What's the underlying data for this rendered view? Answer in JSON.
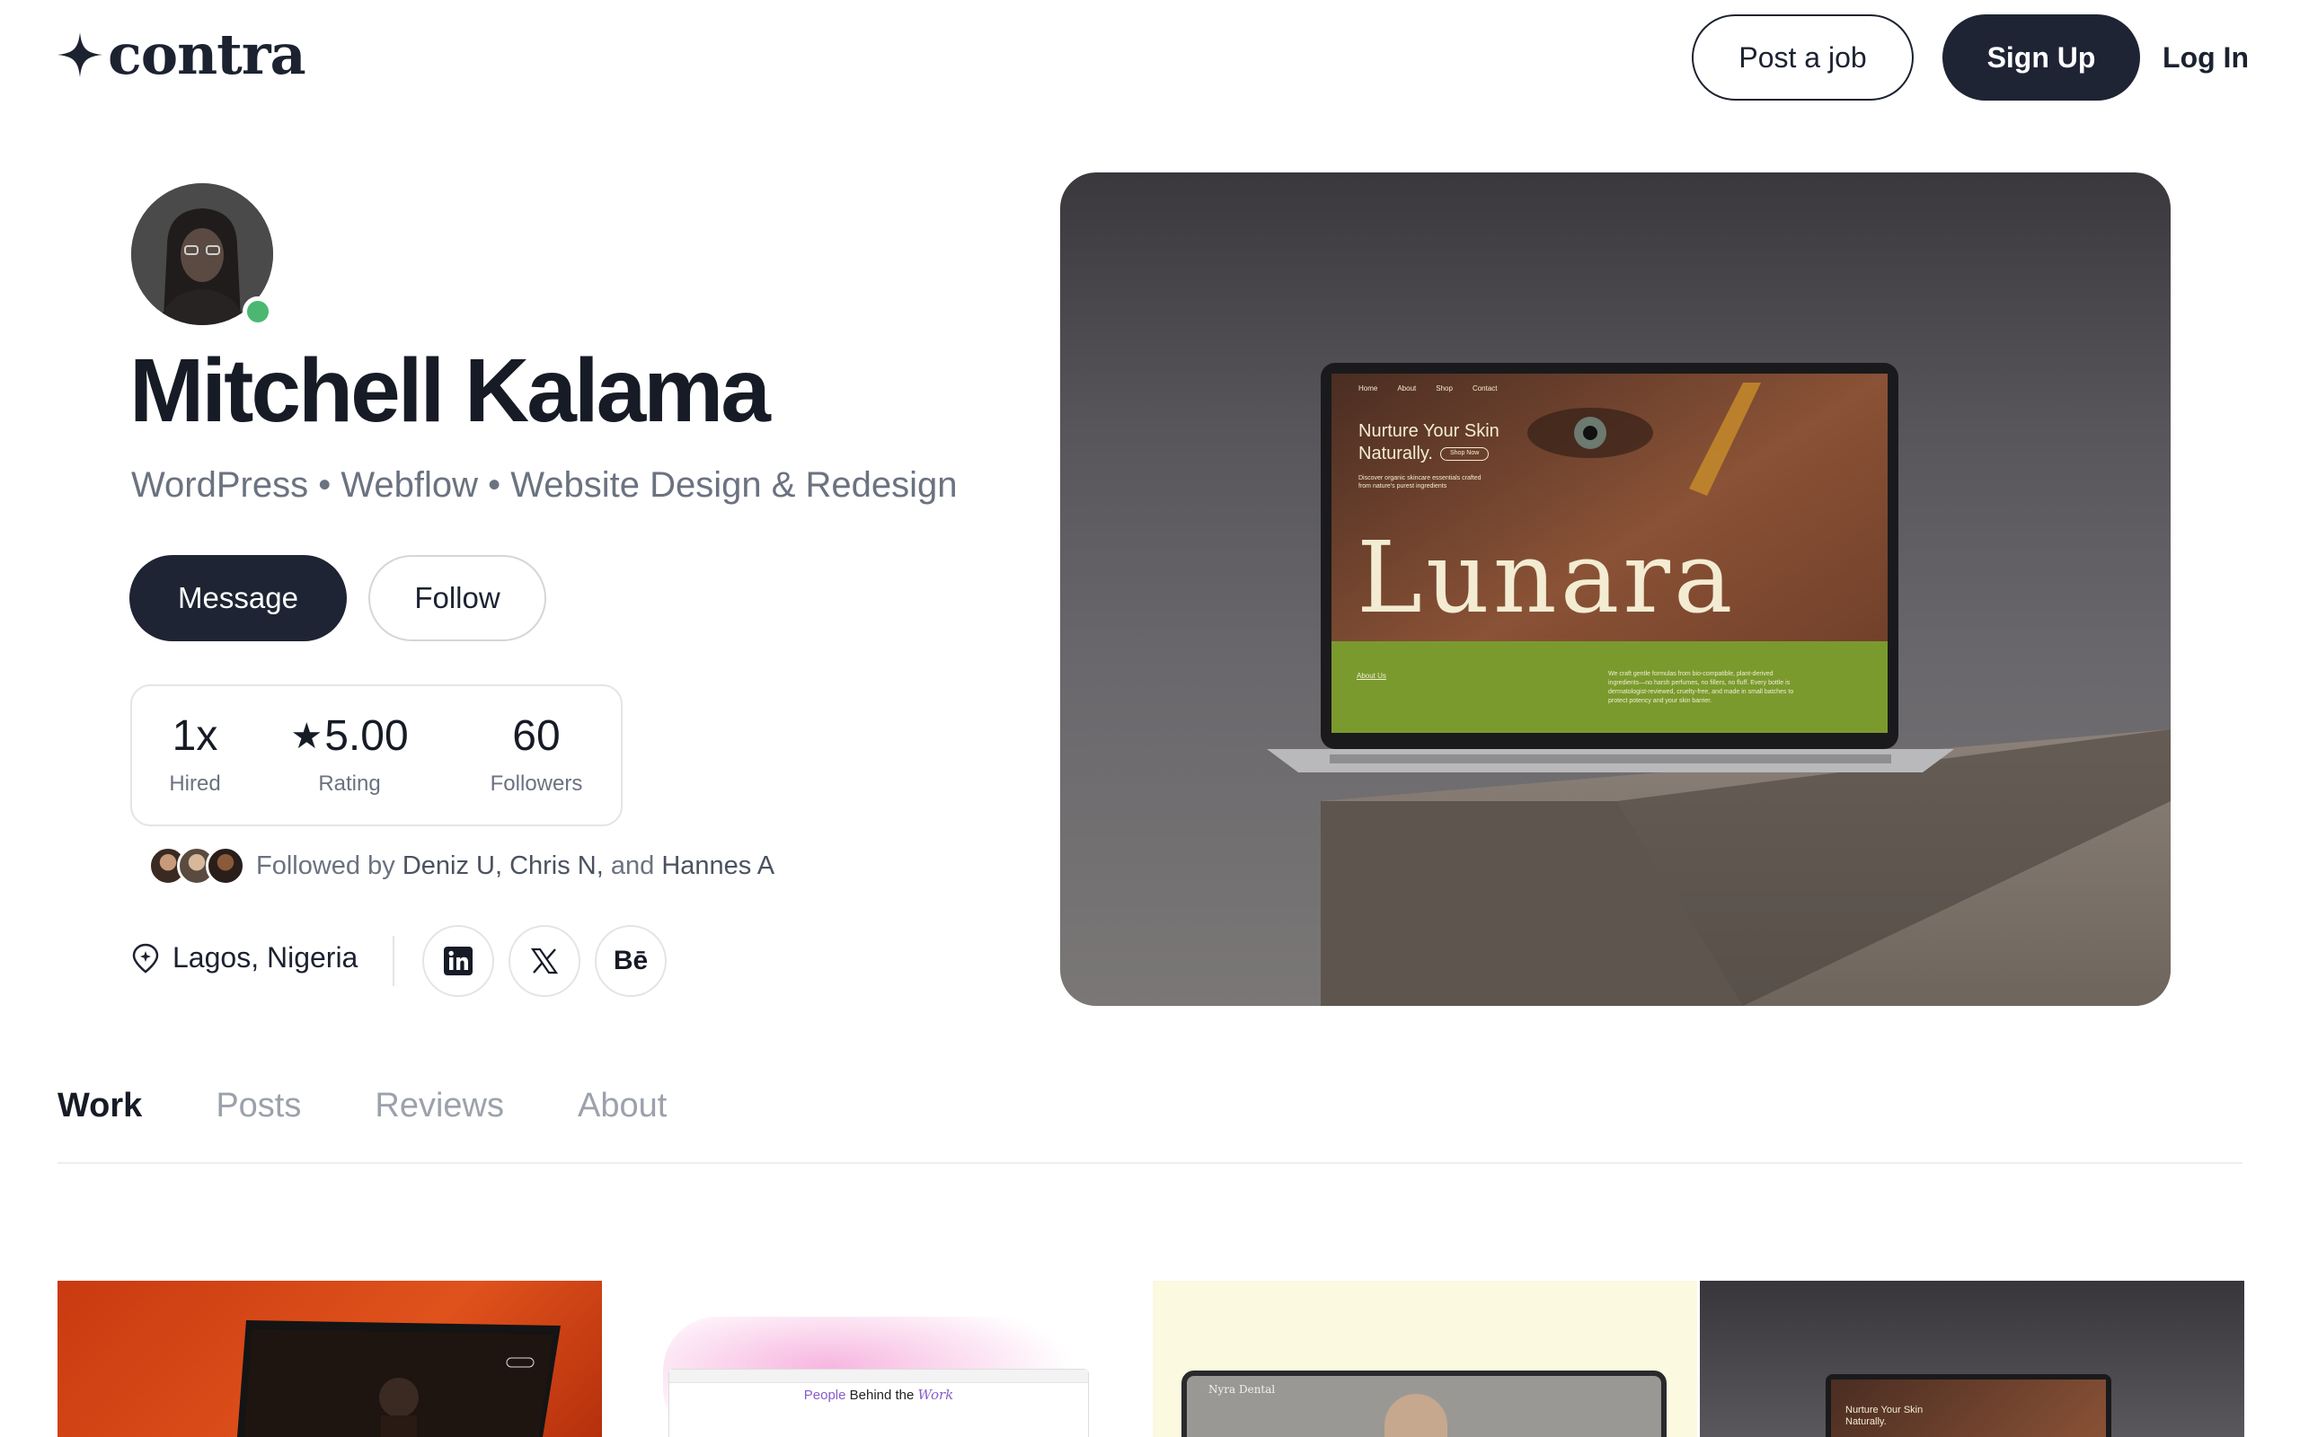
{
  "header": {
    "brand": "contra",
    "post_job_label": "Post a job",
    "sign_up_label": "Sign Up",
    "log_in_label": "Log In"
  },
  "profile": {
    "name": "Mitchell Kalama",
    "skills": "WordPress • Webflow • Website Design & Redesign",
    "online_color": "#4bb872",
    "message_label": "Message",
    "follow_label": "Follow",
    "stats": [
      {
        "value": "1x",
        "label": "Hired"
      },
      {
        "value": "5.00",
        "label": "Rating",
        "icon": "star-icon"
      },
      {
        "value": "60",
        "label": "Followers"
      }
    ],
    "followed_by": {
      "prefix": "Followed by",
      "name1": "Deniz U,",
      "name2": "Chris N,",
      "conj": "and",
      "name3": "Hannes A"
    },
    "location": "Lagos, Nigeria",
    "social": [
      "linkedin-icon",
      "x-icon",
      "behance-icon"
    ],
    "behance_text": "Bē"
  },
  "hero": {
    "nav": [
      "Home",
      "About",
      "Shop",
      "Contact"
    ],
    "headline_1": "Nurture Your Skin",
    "headline_2": "Naturally.",
    "shop_now": "Shop Now",
    "subtext_1": "Discover organic skincare essentials crafted",
    "subtext_2": "from nature's purest ingredients",
    "brand_word": "Lunara",
    "about_us": "About Us",
    "body_1": "We craft gentle formulas from bio-compatible, plant-derived",
    "body_2": "ingredients—no harsh perfumes, no fillers, no fluff. Every bottle is",
    "body_3": "dermatologist-reviewed, cruelty-free, and made in small batches to",
    "body_4": "protect potency and your skin barrier.",
    "accent_green": "#7a9a2e",
    "cream": "#f3ecd2"
  },
  "tabs": [
    "Work",
    "Posts",
    "Reviews",
    "About"
  ],
  "active_tab": "Work",
  "work_cards": {
    "card2_title_a": "People",
    "card2_title_b": "Behind the",
    "card2_title_c": "Work",
    "card3_brand": "Nyra Dental",
    "card4_headline_1": "Nurture Your Skin",
    "card4_headline_2": "Naturally."
  }
}
